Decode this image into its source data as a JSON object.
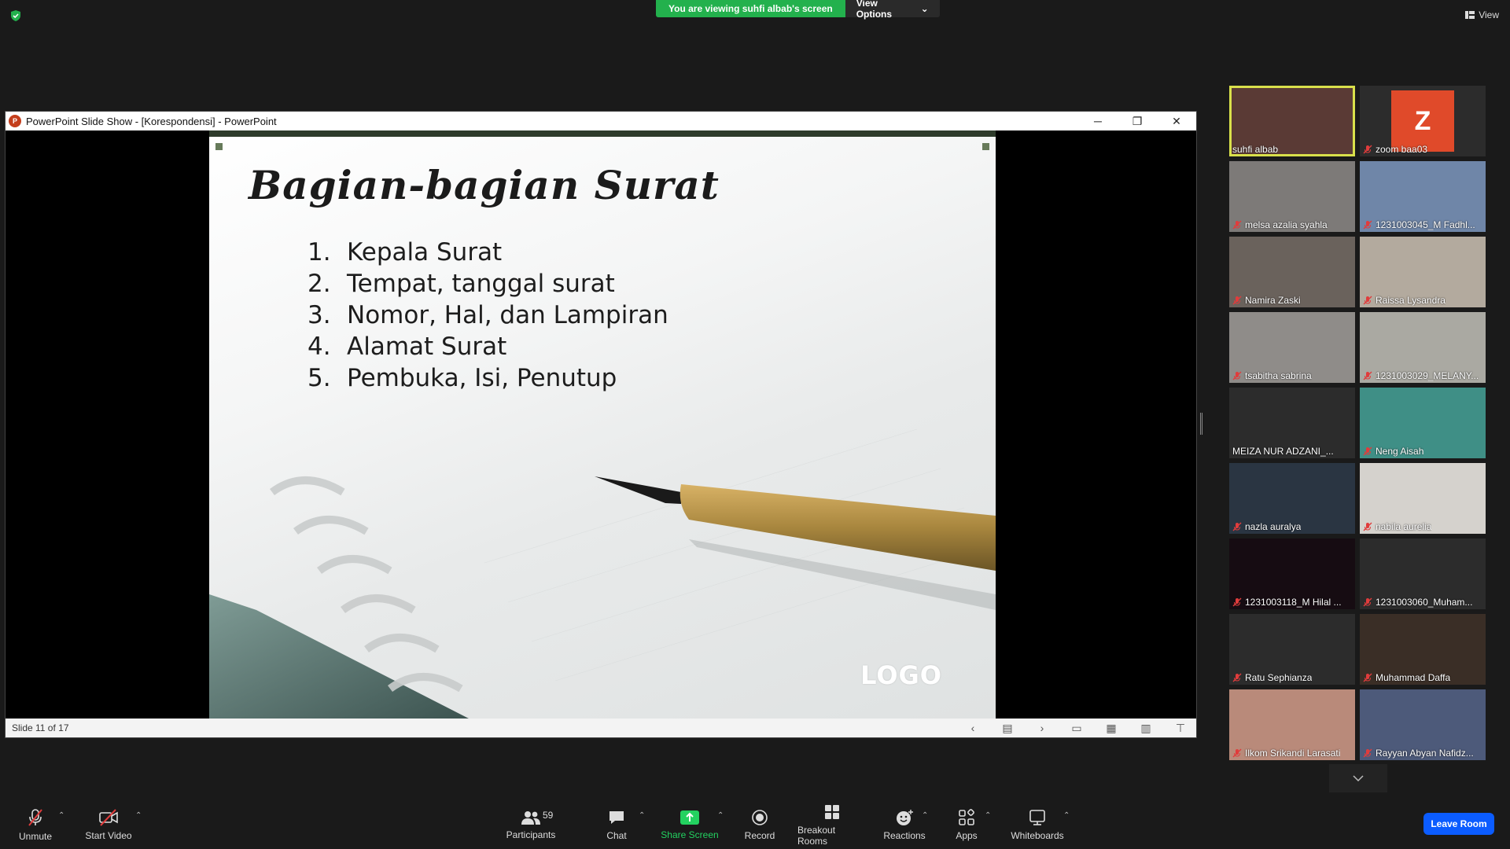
{
  "top": {
    "viewing_banner": "You are viewing suhfi albab's screen",
    "view_options": "View Options",
    "view_label": "View"
  },
  "ppt": {
    "window_title": "PowerPoint Slide Show - [Korespondensi] - PowerPoint",
    "slide_title": "Bagian-bagian Surat",
    "list": [
      {
        "num": "1.",
        "text": "Kepala Surat"
      },
      {
        "num": "2.",
        "text": "Tempat, tanggal surat"
      },
      {
        "num": "3.",
        "text": "Nomor, Hal, dan Lampiran"
      },
      {
        "num": "4.",
        "text": "Alamat Surat"
      },
      {
        "num": "5.",
        "text": "Pembuka, Isi, Penutup"
      }
    ],
    "logo_text": "LOGO",
    "slide_status": "Slide 11 of 17"
  },
  "participants": [
    {
      "name": "suhfi albab",
      "muted": false,
      "active": true,
      "bg": "#5a3a35"
    },
    {
      "name": "zoom baa03",
      "muted": true,
      "avatar_letter": "Z",
      "bg": "#2c2c2c"
    },
    {
      "name": "melsa azalia syahla",
      "muted": true,
      "bg": "#7d7a78"
    },
    {
      "name": "1231003045_M Fadhl...",
      "muted": true,
      "bg": "#6f86a8"
    },
    {
      "name": "Namira Zaski",
      "muted": true,
      "bg": "#6a625c"
    },
    {
      "name": "Raissa Lysandra",
      "muted": true,
      "bg": "#b3aa9e"
    },
    {
      "name": "tsabitha sabrina",
      "muted": true,
      "bg": "#8f8c89"
    },
    {
      "name": "1231003029_MELANY...",
      "muted": true,
      "bg": "#aaa9a2"
    },
    {
      "name": "MEIZA NUR ADZANI_...",
      "muted": false,
      "bg": "#2c2c2c"
    },
    {
      "name": "Neng Aisah",
      "muted": true,
      "bg": "#3f8f86"
    },
    {
      "name": "nazla auralya",
      "muted": true,
      "bg": "#2a3542"
    },
    {
      "name": "nabila aurelia",
      "muted": true,
      "bg": "#d5d2cd"
    },
    {
      "name": "1231003118_M Hilal ...",
      "muted": true,
      "bg": "#160c12"
    },
    {
      "name": "1231003060_Muham...",
      "muted": true,
      "bg": "#2c2c2c"
    },
    {
      "name": "Ratu Sephianza",
      "muted": true,
      "bg": "#2c2c2c"
    },
    {
      "name": "Muhammad Daffa",
      "muted": true,
      "bg": "#3a2e26"
    },
    {
      "name": "Ilkom Srikandi Larasati",
      "muted": true,
      "bg": "#b98a7a"
    },
    {
      "name": "Rayyan Abyan Nafidz...",
      "muted": true,
      "bg": "#4d5a7a"
    }
  ],
  "toolbar": {
    "unmute": "Unmute",
    "start_video": "Start Video",
    "participants": "Participants",
    "participant_count": "59",
    "chat": "Chat",
    "share_screen": "Share Screen",
    "record": "Record",
    "breakout_rooms": "Breakout Rooms",
    "reactions": "Reactions",
    "apps": "Apps",
    "whiteboards": "Whiteboards",
    "leave_room": "Leave Room"
  },
  "colors": {
    "share_green": "#23d160",
    "banner_green": "#23b14d",
    "leave_blue": "#0b5cff",
    "active_speaker": "#d9e04b"
  }
}
